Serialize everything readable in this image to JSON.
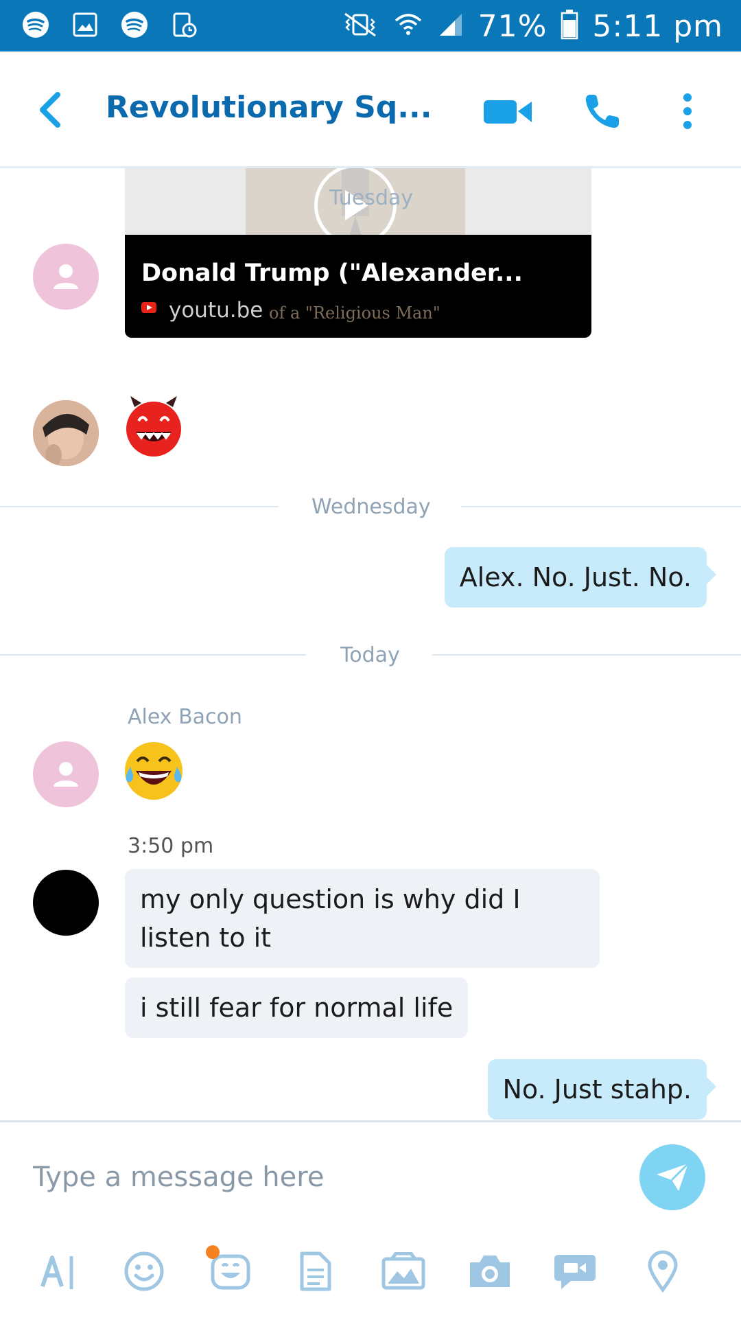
{
  "status_bar": {
    "battery": "71%",
    "time": "5:11 pm",
    "left_icons": [
      "spotify-icon",
      "gallery-icon",
      "spotify-icon",
      "screen-record-icon"
    ],
    "right_icons": [
      "vibrate-icon",
      "wifi-icon",
      "signal-icon",
      "battery-icon"
    ]
  },
  "header": {
    "title": "Revolutionary Sq...",
    "back_icon": "chevron-left-icon",
    "video_call_icon": "video-camera-icon",
    "call_icon": "phone-icon",
    "menu_icon": "more-vertical-icon"
  },
  "conversation": {
    "link_card": {
      "day_overlay": "Tuesday",
      "title": "Donald Trump (\"Alexander...",
      "domain": "youtu.be",
      "thumb_text": "of a \"Religious Man\""
    },
    "emoji_message": "devil-emoji",
    "days": {
      "wednesday": "Wednesday",
      "today": "Today"
    },
    "outgoing_1": "Alex. No. Just. No.",
    "sender": "Alex Bacon",
    "laugh_emoji": "laughing-tears-emoji",
    "time": "3:50 pm",
    "incoming_1": "my only question is why did I listen to it",
    "incoming_2": "i still fear for normal life",
    "outgoing_2": "No. Just stahp."
  },
  "input": {
    "placeholder": "Type a message here",
    "send_icon": "send-icon"
  },
  "toolbar": {
    "icons": [
      "text-format-icon",
      "emoticon-icon",
      "mojis-icon",
      "file-icon",
      "media-icon",
      "camera-icon",
      "video-message-icon",
      "location-icon"
    ]
  },
  "colors": {
    "status_bar": "#0a78b8",
    "accent": "#0a6aad",
    "outgoing_bubble": "#c8ebfb",
    "incoming_bubble": "#eef2f6",
    "send_button": "#7fd3f3",
    "avatar_pink": "#efc4da"
  }
}
